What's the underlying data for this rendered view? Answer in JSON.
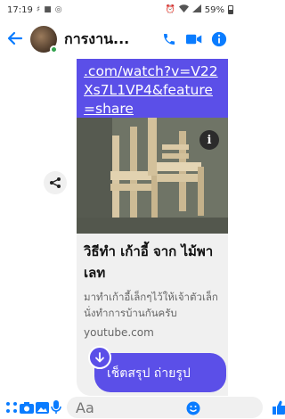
{
  "status": {
    "time": "17:19",
    "battery": "59%"
  },
  "header": {
    "title": "การงาน..."
  },
  "message": {
    "link_text": ".com/watch?v=V22Xs7L1VP4&feature=share",
    "card_title": "วิธีทำ เก้าอี้ จาก ไม้พาเลท",
    "card_desc": "มาทำเก้าอี้เล็กๆไว้ให้เจ้าตัวเล็กนั่งทำการบ้านกันครับ",
    "card_domain": "youtube.com",
    "info_badge": "i"
  },
  "next_message": {
    "text": "เช็ตสรุป ถ่ายรูป"
  },
  "composer": {
    "placeholder": "Aa"
  },
  "colors": {
    "accent": "#0a7cff",
    "bubble": "#5b4fe8"
  }
}
